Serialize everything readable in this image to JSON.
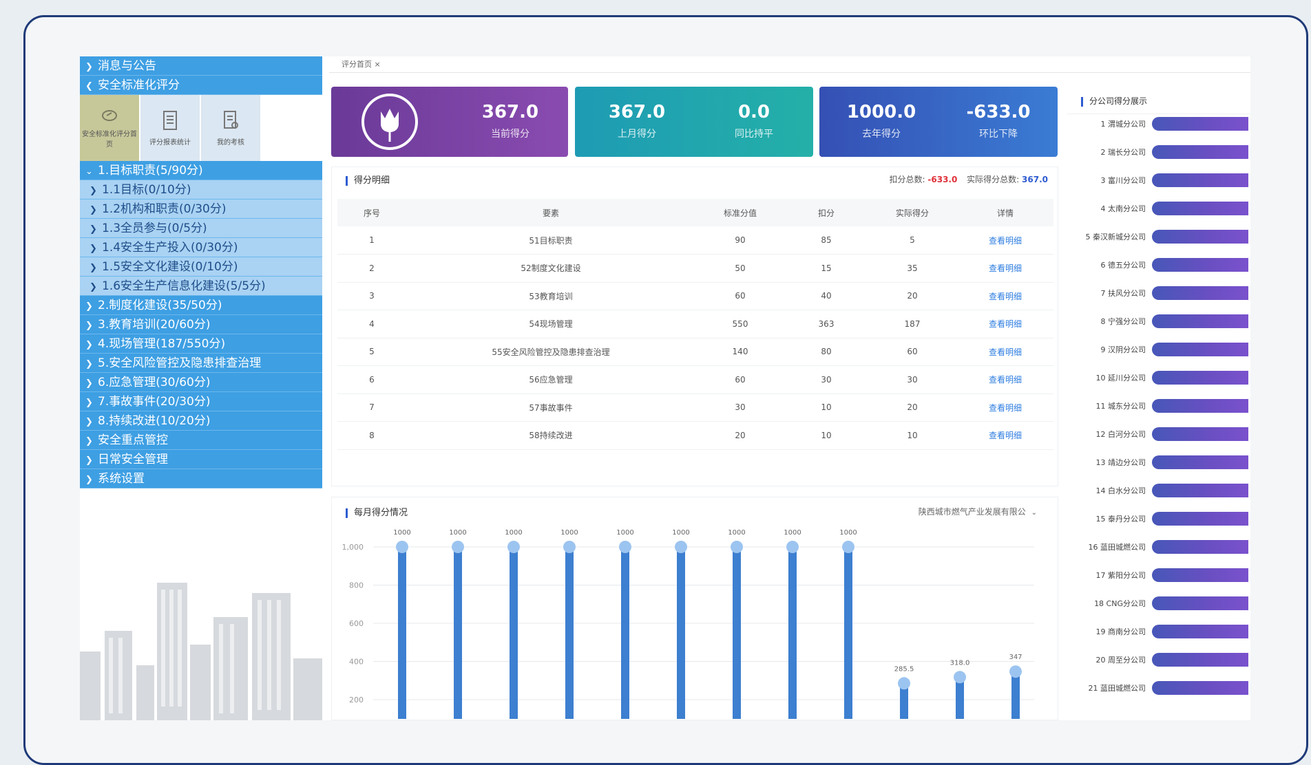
{
  "sidebar": {
    "top_items": [
      "消息与公告",
      "安全标准化评分"
    ],
    "quick_tiles": [
      "安全标准化评分首页",
      "评分报表统计",
      "我的考核"
    ],
    "section_open": "1.目标职责(5/90分)",
    "sub_items": [
      "1.1目标(0/10分)",
      "1.2机构和职责(0/30分)",
      "1.3全员参与(0/5分)",
      "1.4安全生产投入(0/30分)",
      "1.5安全文化建设(0/10分)",
      "1.6安全生产信息化建设(5/5分)"
    ],
    "sections": [
      "2.制度化建设(35/50分)",
      "3.教育培训(20/60分)",
      "4.现场管理(187/550分)",
      "5.安全风险管控及隐患排查治理",
      "6.应急管理(30/60分)",
      "7.事故事件(20/30分)",
      "8.持续改进(10/20分)",
      "安全重点管控",
      "日常安全管理",
      "系统设置"
    ]
  },
  "tab": {
    "label": "评分首页 ×"
  },
  "kpis": [
    {
      "value": "367.0",
      "label": "当前得分"
    },
    {
      "value": "367.0",
      "label": "上月得分"
    },
    {
      "value": "0.0",
      "label": "同比持平"
    },
    {
      "value": "1000.0",
      "label": "去年得分"
    },
    {
      "value": "-633.0",
      "label": "环比下降"
    }
  ],
  "detail": {
    "title": "得分明细",
    "deduct_label": "扣分总数:",
    "deduct_value": "-633.0",
    "actual_label": "实际得分总数:",
    "actual_value": "367.0",
    "columns": [
      "序号",
      "要素",
      "标准分值",
      "扣分",
      "实际得分",
      "详情"
    ],
    "rows": [
      [
        "1",
        "51目标职责",
        "90",
        "85",
        "5",
        "查看明细"
      ],
      [
        "2",
        "52制度文化建设",
        "50",
        "15",
        "35",
        "查看明细"
      ],
      [
        "3",
        "53教育培训",
        "60",
        "40",
        "20",
        "查看明细"
      ],
      [
        "4",
        "54现场管理",
        "550",
        "363",
        "187",
        "查看明细"
      ],
      [
        "5",
        "55安全风险管控及隐患排查治理",
        "140",
        "80",
        "60",
        "查看明细"
      ],
      [
        "6",
        "56应急管理",
        "60",
        "30",
        "30",
        "查看明细"
      ],
      [
        "7",
        "57事故事件",
        "30",
        "10",
        "20",
        "查看明细"
      ],
      [
        "8",
        "58持续改进",
        "20",
        "10",
        "10",
        "查看明细"
      ]
    ]
  },
  "monthly": {
    "title": "每月得分情况",
    "company_select": "陕西城市燃气产业发展有限公"
  },
  "chart_data": {
    "type": "bar",
    "title": "每月得分情况",
    "ylim": [
      200,
      1000
    ],
    "y_ticks": [
      "1,000",
      "800",
      "600",
      "400",
      "200"
    ],
    "values": [
      1000,
      1000,
      1000,
      1000,
      1000,
      1000,
      1000,
      1000,
      1000,
      285.5,
      318.0,
      347
    ],
    "value_labels": [
      "1000",
      "1000",
      "1000",
      "1000",
      "1000",
      "1000",
      "1000",
      "1000",
      "1000",
      "285.5",
      "318.0",
      "347"
    ],
    "color": "#3d7fd0",
    "grid": true
  },
  "rank": {
    "title": "分公司得分展示",
    "items": [
      "1 渭城分公司",
      "2 瑞长分公司",
      "3 富川分公司",
      "4 太南分公司",
      "5 秦汉新城分公司",
      "6 德五分公司",
      "7 扶风分公司",
      "8 宁强分公司",
      "9 汉阴分公司",
      "10 延川分公司",
      "11 城东分公司",
      "12 白河分公司",
      "13 靖边分公司",
      "14 白水分公司",
      "15 泰丹分公司",
      "16 蓝田城燃公司",
      "17 紫阳分公司",
      "18 CNG分公司",
      "19 商南分公司",
      "20 周至分公司",
      "21 蓝田城燃公司"
    ]
  }
}
